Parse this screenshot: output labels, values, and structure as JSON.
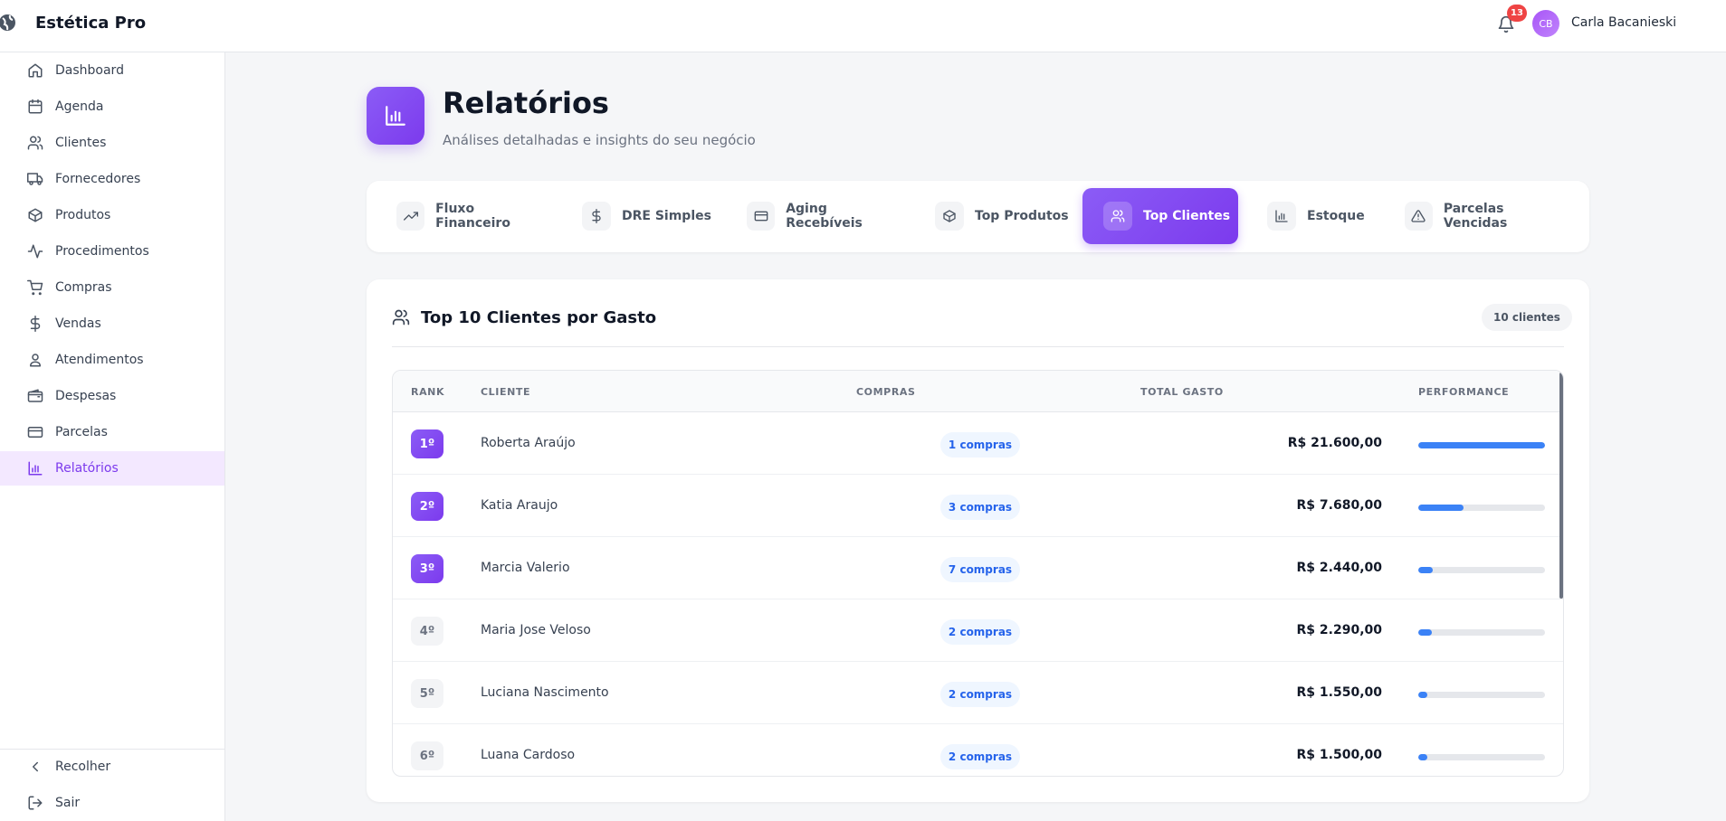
{
  "app": {
    "name": "Estética Pro"
  },
  "header": {
    "notification_count": "13",
    "user_initials": "CB",
    "user_name": "Carla Bacanieski"
  },
  "sidebar": {
    "items": [
      {
        "label": "Dashboard",
        "icon": "home-icon"
      },
      {
        "label": "Agenda",
        "icon": "calendar-icon"
      },
      {
        "label": "Clientes",
        "icon": "users-icon"
      },
      {
        "label": "Fornecedores",
        "icon": "truck-icon"
      },
      {
        "label": "Produtos",
        "icon": "package-icon"
      },
      {
        "label": "Procedimentos",
        "icon": "activity-icon"
      },
      {
        "label": "Compras",
        "icon": "cart-icon"
      },
      {
        "label": "Vendas",
        "icon": "dollar-icon"
      },
      {
        "label": "Atendimentos",
        "icon": "user-pin-icon"
      },
      {
        "label": "Despesas",
        "icon": "wallet-icon"
      },
      {
        "label": "Parcelas",
        "icon": "credit-card-icon"
      },
      {
        "label": "Relatórios",
        "icon": "bar-chart-icon",
        "active": true
      }
    ],
    "collapse_label": "Recolher",
    "logout_label": "Sair"
  },
  "page": {
    "title": "Relatórios",
    "subtitle": "Análises detalhadas e insights do seu negócio"
  },
  "tabs": [
    {
      "label": "Fluxo Financeiro",
      "icon": "trending-up-icon"
    },
    {
      "label": "DRE Simples",
      "icon": "dollar-icon"
    },
    {
      "label": "Aging Recebíveis",
      "icon": "credit-card-icon"
    },
    {
      "label": "Top Produtos",
      "icon": "package-icon"
    },
    {
      "label": "Top Clientes",
      "icon": "users-icon",
      "active": true
    },
    {
      "label": "Estoque",
      "icon": "bar-chart-icon"
    },
    {
      "label": "Parcelas Vencidas",
      "icon": "warning-icon"
    }
  ],
  "report": {
    "title": "Top 10 Clientes por Gasto",
    "count_badge": "10 clientes",
    "columns": [
      "RANK",
      "CLIENTE",
      "COMPRAS",
      "TOTAL GASTO",
      "PERFORMANCE"
    ],
    "rows": [
      {
        "rank": "1º",
        "name": "Roberta Araújo",
        "purchases": "1 compras",
        "total": "R$ 21.600,00",
        "performance": 1.0
      },
      {
        "rank": "2º",
        "name": "Katia Araujo",
        "purchases": "3 compras",
        "total": "R$ 7.680,00",
        "performance": 0.356
      },
      {
        "rank": "3º",
        "name": "Marcia Valerio",
        "purchases": "7 compras",
        "total": "R$ 2.440,00",
        "performance": 0.113
      },
      {
        "rank": "4º",
        "name": "Maria Jose Veloso",
        "purchases": "2 compras",
        "total": "R$ 2.290,00",
        "performance": 0.106
      },
      {
        "rank": "5º",
        "name": "Luciana Nascimento",
        "purchases": "2 compras",
        "total": "R$ 1.550,00",
        "performance": 0.072
      },
      {
        "rank": "6º",
        "name": "Luana Cardoso",
        "purchases": "2 compras",
        "total": "R$ 1.500,00",
        "performance": 0.069
      }
    ]
  },
  "colors": {
    "accent": "#7c3aed",
    "accent_light": "#f3e8ff",
    "performance_bar": "#3b82f6",
    "badge_red": "#ef4444"
  }
}
